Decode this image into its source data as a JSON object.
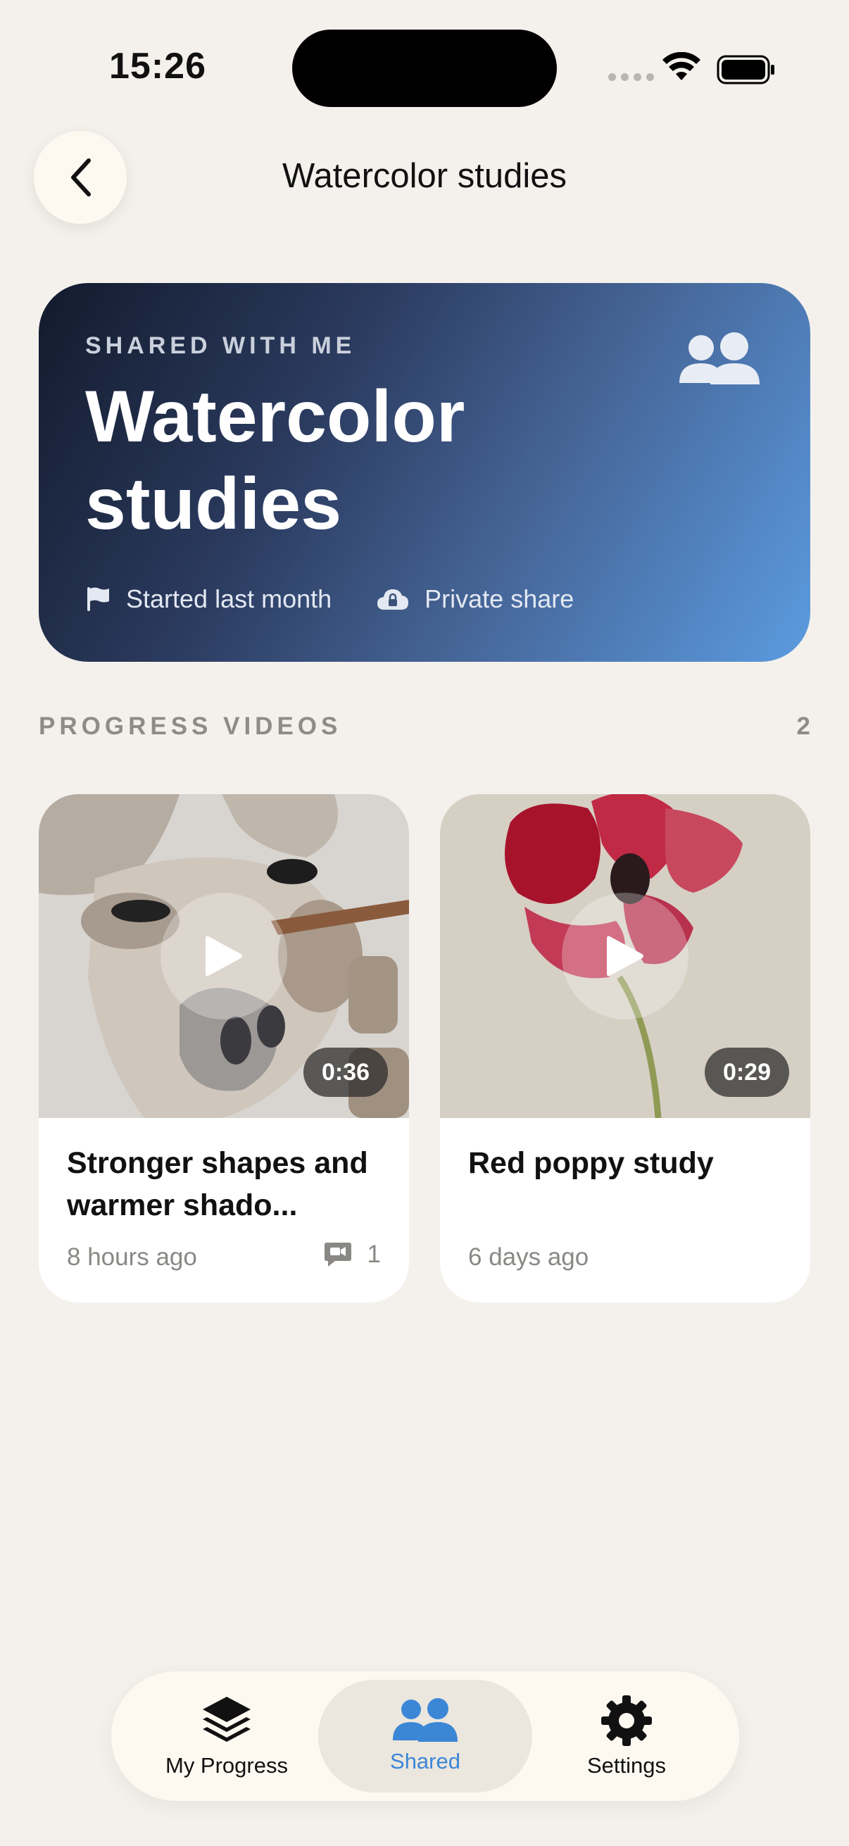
{
  "status_bar": {
    "time": "15:26"
  },
  "header": {
    "title": "Watercolor studies",
    "back_icon": "chevron-left-icon"
  },
  "hero": {
    "kicker": "SHARED WITH ME",
    "title": "Watercolor studies",
    "started": "Started last month",
    "privacy": "Private share",
    "colors": {
      "start": "#121a2c",
      "end": "#5b9be0"
    }
  },
  "section": {
    "label": "PROGRESS VIDEOS",
    "count": "2"
  },
  "videos": [
    {
      "title": "Stronger shapes and warmer shado...",
      "age": "8 hours ago",
      "duration": "0:36",
      "comments": "1"
    },
    {
      "title": "Red poppy study",
      "age": "6 days ago",
      "duration": "0:29"
    }
  ],
  "tabbar": {
    "tabs": [
      {
        "label": "My Progress",
        "icon": "layers-icon"
      },
      {
        "label": "Shared",
        "icon": "people-icon",
        "active": true
      },
      {
        "label": "Settings",
        "icon": "gear-icon"
      }
    ],
    "accent": "#3c86d6"
  }
}
